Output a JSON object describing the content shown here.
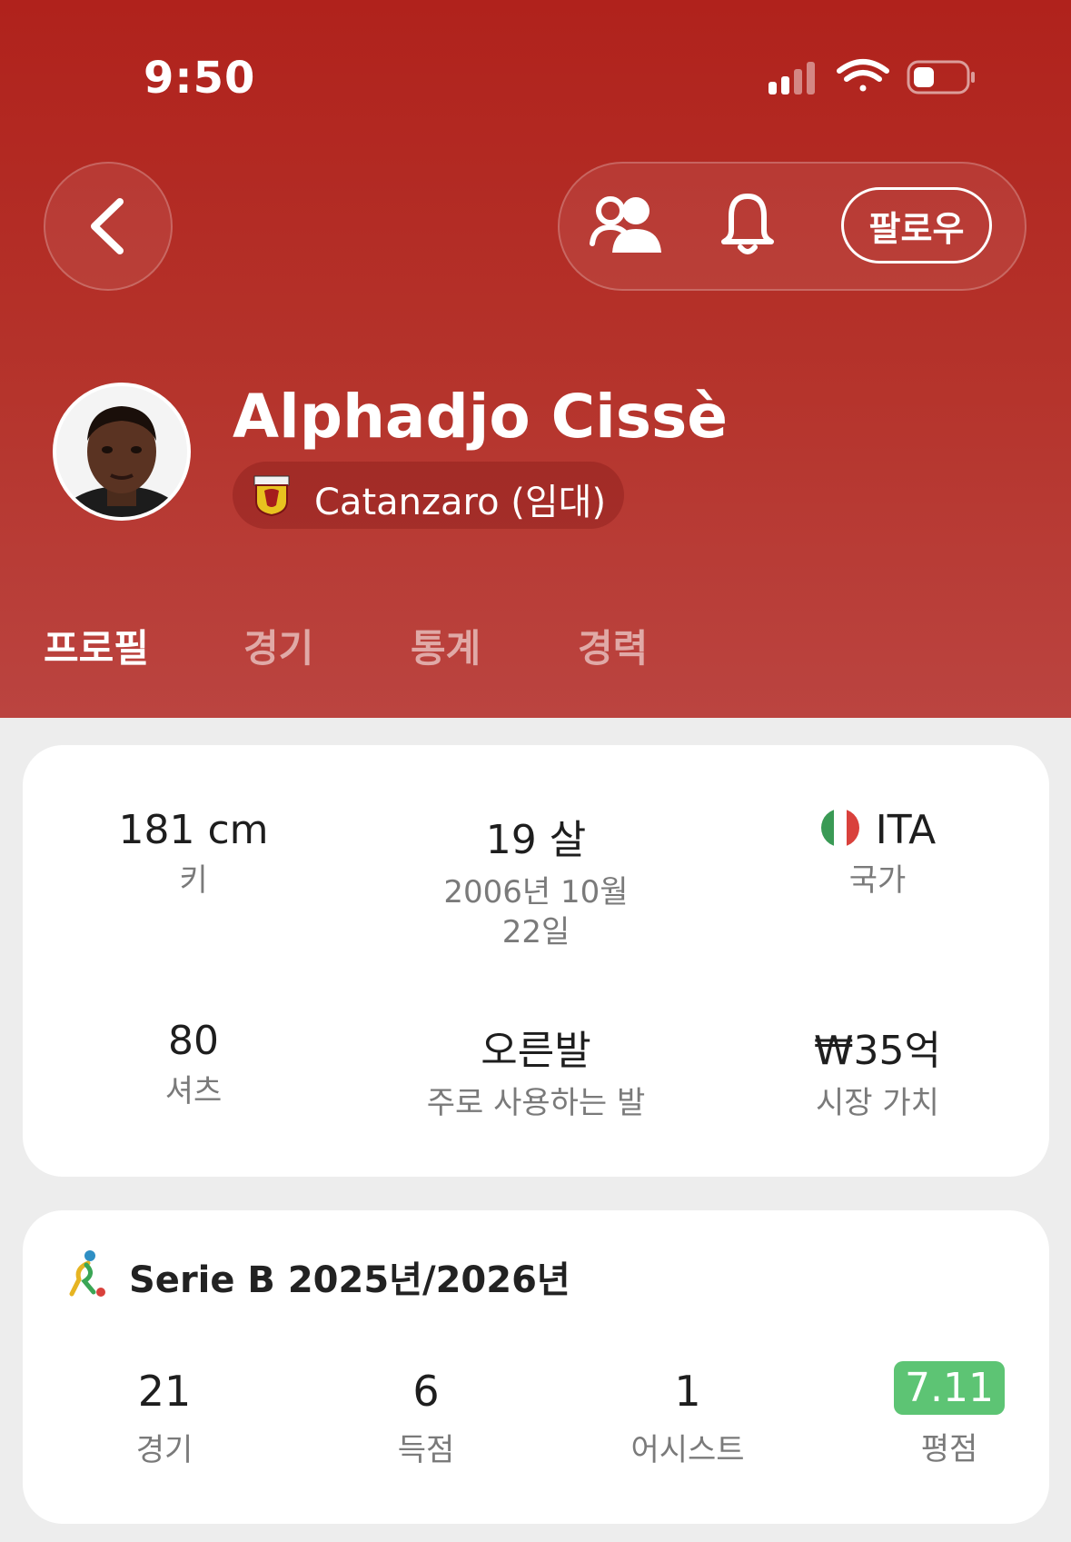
{
  "status_bar": {
    "time": "9:50",
    "icons": [
      "signal-icon",
      "wifi-icon",
      "battery-icon"
    ]
  },
  "header": {
    "back_icon": "chevron-left-icon",
    "actions": {
      "people_icon": "people-icon",
      "bell_icon": "bell-icon",
      "follow_label": "팔로우"
    },
    "player_name": "Alphadjo Cissè",
    "club": "Catanzaro (임대)"
  },
  "tabs": [
    {
      "label": "프로필",
      "active": true
    },
    {
      "label": "경기",
      "active": false
    },
    {
      "label": "통계",
      "active": false
    },
    {
      "label": "경력",
      "active": false
    }
  ],
  "profile": {
    "height": {
      "value": "181 cm",
      "label": "키"
    },
    "age": {
      "value": "19 살",
      "label_line1": "2006년 10월",
      "label_line2": "22일"
    },
    "country": {
      "value": "ITA",
      "label": "국가"
    },
    "shirt": {
      "value": "80",
      "label": "셔츠"
    },
    "foot": {
      "value": "오른발",
      "label": "주로 사용하는 발"
    },
    "market_value": {
      "value": "₩35억",
      "label": "시장 가치"
    }
  },
  "season": {
    "league": "Serie B 2025년/2026년",
    "stats": [
      {
        "value": "21",
        "label": "경기"
      },
      {
        "value": "6",
        "label": "득점"
      },
      {
        "value": "1",
        "label": "어시스트"
      },
      {
        "value": "7.11",
        "label": "평점"
      }
    ]
  },
  "colors": {
    "header": "#b0221c",
    "rating_badge": "#5dc474"
  }
}
